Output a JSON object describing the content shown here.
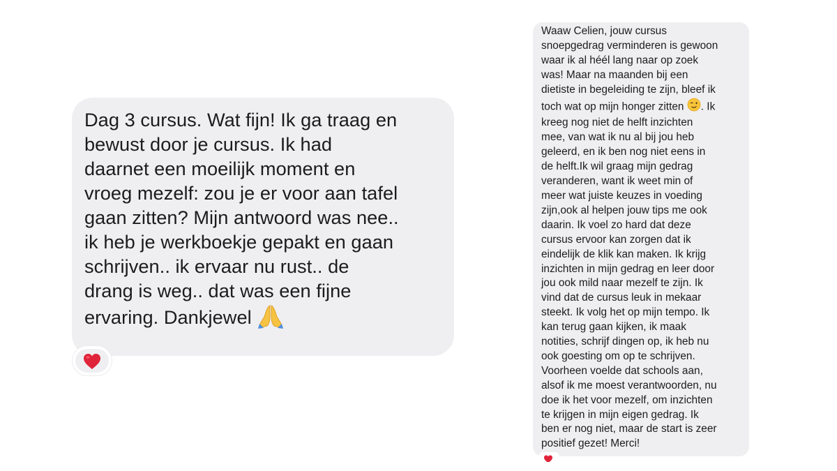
{
  "messages": [
    {
      "text_before_emoji": "Dag 3 cursus. Wat fijn! Ik ga traag en\nbewust door je cursus. Ik had\ndaarnet een moeilijk moment en\nvroeg mezelf: zou je er voor aan tafel\ngaan zitten? Mijn antwoord was nee..\nik heb je werkboekje gepakt en gaan\nschrijven.. ik ervaar nu rust.. de\ndrang is weg.. dat was een fijne\nervaring. Dankjewel ",
      "inline_emoji": "folded-hands",
      "reaction": "red-heart"
    },
    {
      "text_before_emoji": "Waaw Celien, jouw cursus\nsnoepgedrag verminderen is gewoon\nwaar ik al héél lang naar op zoek\nwas! Maar na maanden bij een\ndietiste in begeleiding te zijn, bleef ik\ntoch wat op mijn honger zitten ",
      "inline_emoji": "winking-face",
      "text_after_emoji": ". Ik\nkreeg nog niet de helft inzichten\nmee, van wat ik nu al bij jou heb\ngeleerd, en ik ben nog niet eens in\nde helft.Ik wil graag mijn gedrag\nveranderen, want ik weet min of\nmeer wat juiste keuzes in voeding\nzijn,ook al helpen jouw tips me ook\ndaarin. Ik voel zo hard dat deze\ncursus ervoor kan zorgen dat ik\neindelijk de klik kan maken. Ik krijg\ninzichten in mijn gedrag en leer door\njou ook mild naar mezelf te zijn. Ik\nvind dat de cursus leuk in mekaar\nsteekt. Ik volg het op mijn tempo. Ik\nkan terug gaan kijken, ik maak\nnotities, schrijf dingen op, ik heb nu\nook goesting om op te schrijven.\nVoorheen voelde dat schools aan,\nalsof ik me moest verantwoorden, nu\ndoe ik het voor mezelf, om inzichten\nte krijgen in mijn eigen gedrag. Ik\nben er nog niet, maar de start is zeer\npositief gezet! Merci!",
      "reaction": "red-heart"
    }
  ],
  "colors": {
    "bubble": "#efeff1",
    "text": "#1c1c1e",
    "heart": "#e0243a",
    "background": "#ffffff"
  }
}
